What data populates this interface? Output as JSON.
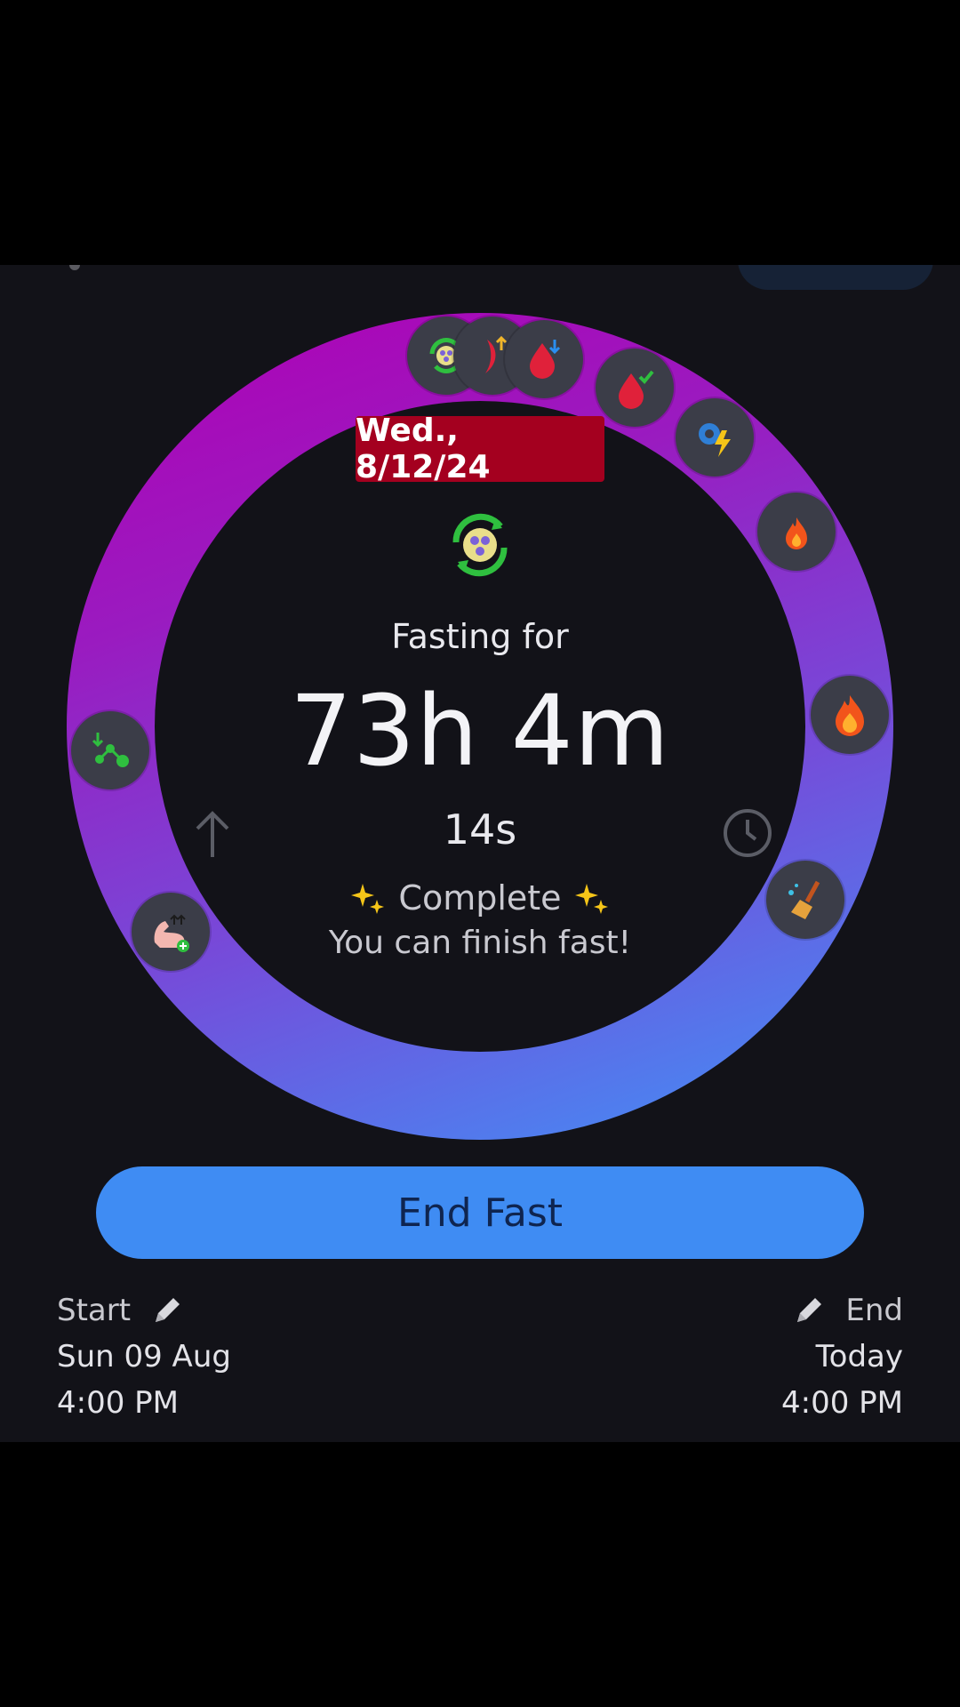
{
  "tracker": {
    "date_tag": "Wed., 8/12/24",
    "fasting_label": "Fasting for",
    "elapsed_hm": "73h 4m",
    "elapsed_seconds": "14s",
    "status": "Complete",
    "status_message": "You can finish fast!",
    "ring_colors": [
      "#b000b4",
      "#7848d8",
      "#3f93f7"
    ]
  },
  "stage_icons": [
    "autophagy-icon",
    "blood-sugar-rise-icon",
    "blood-sugar-drop-icon",
    "blood-sugar-normal-icon",
    "metabolism-boost-icon",
    "fat-burn-icon",
    "fat-burn-strong-icon",
    "cleanse-icon",
    "muscle-growth-icon",
    "molecule-icon"
  ],
  "actions": {
    "end_fast_label": "End Fast",
    "end_fast_color": "#3f8cf3"
  },
  "start": {
    "label": "Start",
    "date": "Sun 09 Aug",
    "time": "4:00 PM"
  },
  "end": {
    "label": "End",
    "date": "Today",
    "time": "4:00 PM"
  }
}
